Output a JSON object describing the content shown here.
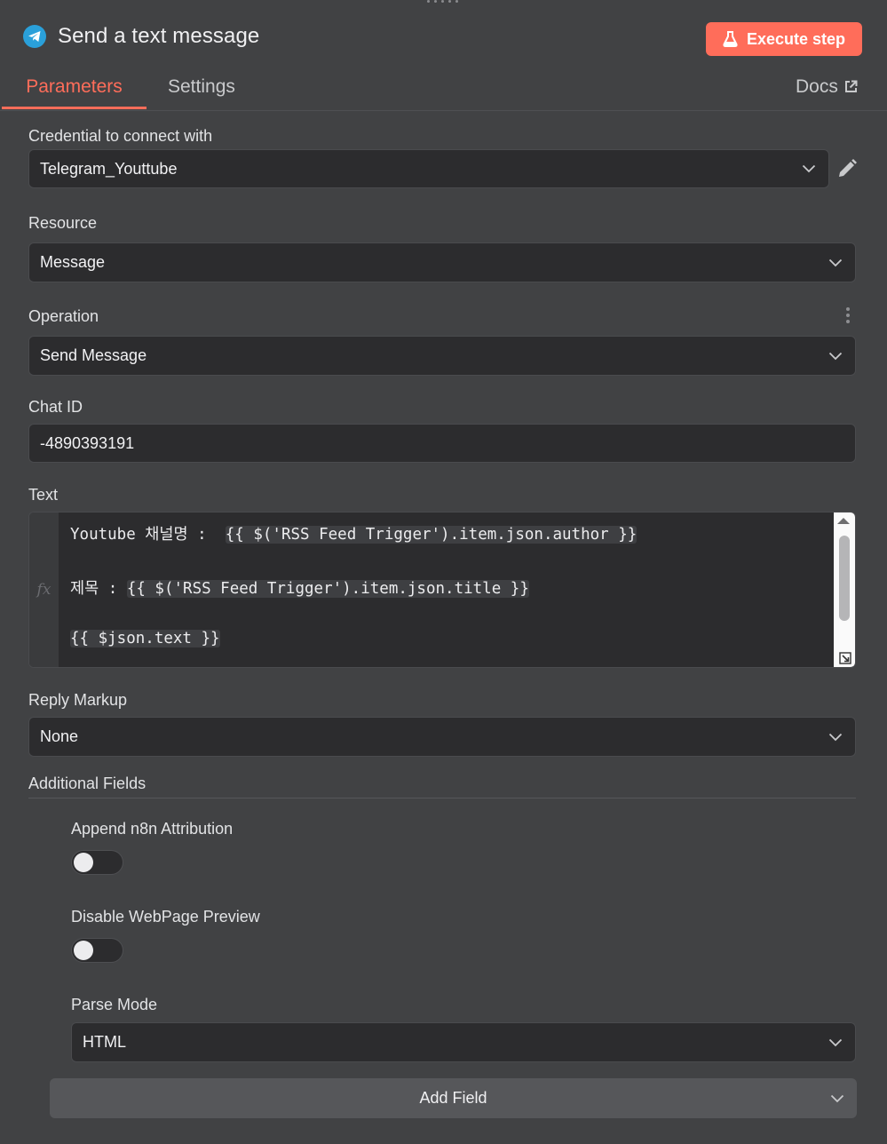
{
  "header": {
    "title": "Send a text message",
    "execute_label": "Execute step",
    "tabs": {
      "parameters": "Parameters",
      "settings": "Settings",
      "docs": "Docs"
    }
  },
  "credential": {
    "label": "Credential to connect with",
    "value": "Telegram_Youttube"
  },
  "resource": {
    "label": "Resource",
    "value": "Message"
  },
  "operation": {
    "label": "Operation",
    "value": "Send Message"
  },
  "chat_id": {
    "label": "Chat ID",
    "value": "-4890393191"
  },
  "text": {
    "label": "Text",
    "line1_prefix": "Youtube 채널명 :  ",
    "line1_expr": "{{ $('RSS Feed Trigger').item.json.author }}",
    "line2_prefix": "제목 : ",
    "line2_expr": "{{ $('RSS Feed Trigger').item.json.title }}",
    "line3_expr": "{{ $json.text }}"
  },
  "reply_markup": {
    "label": "Reply Markup",
    "value": "None"
  },
  "additional_fields": {
    "label": "Additional Fields",
    "append_attribution": {
      "label": "Append n8n Attribution",
      "on": false
    },
    "disable_preview": {
      "label": "Disable WebPage Preview",
      "on": false
    },
    "parse_mode": {
      "label": "Parse Mode",
      "value": "HTML"
    },
    "add_field_label": "Add Field"
  },
  "colors": {
    "accent": "#ff6d5a",
    "telegram": "#2aa0da",
    "background": "#414244",
    "input_bg": "#2c2c2e"
  }
}
